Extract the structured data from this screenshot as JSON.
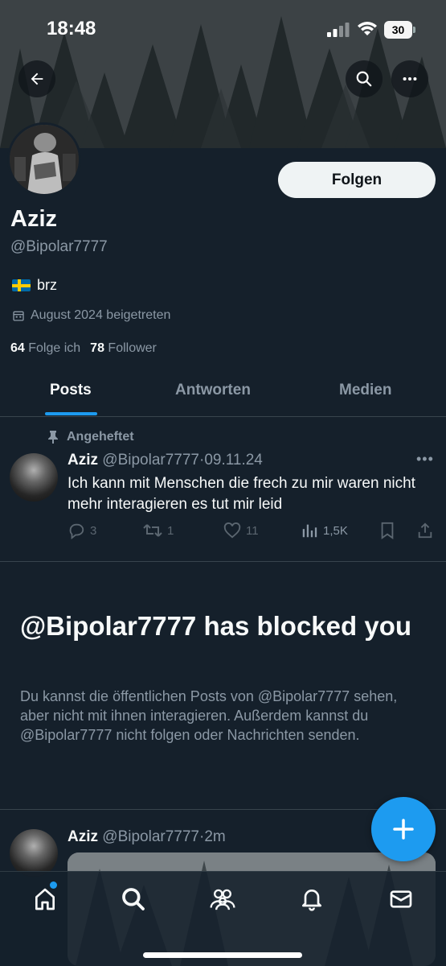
{
  "status_bar": {
    "time": "18:48",
    "battery": "30"
  },
  "profile": {
    "name": "Aziz",
    "handle": "@Bipolar7777",
    "bio": "brz",
    "joined": "August 2024 beigetreten",
    "following_count": "64",
    "following_label": "Folge ich",
    "followers_count": "78",
    "followers_label": "Follower",
    "follow_button": "Folgen"
  },
  "tabs": [
    {
      "label": "Posts",
      "active": true
    },
    {
      "label": "Antworten",
      "active": false
    },
    {
      "label": "Medien",
      "active": false
    }
  ],
  "pinned_tweet": {
    "pinned_label": "Angeheftet",
    "author": "Aziz",
    "handle": "@Bipolar7777",
    "date": "09.11.24",
    "text": "Ich kann mit Menschen die frech zu mir waren nicht mehr interagieren es tut mir leid",
    "replies": "3",
    "retweets": "1",
    "likes": "11",
    "views": "1,5K"
  },
  "blocked": {
    "title": "@Bipolar7777 has blocked you",
    "text": "Du kannst die öffentlichen Posts von @Bipolar7777 sehen, aber nicht mit ihnen interagieren. Außerdem kannst du @Bipolar7777 nicht folgen oder Nachrichten senden."
  },
  "second_tweet": {
    "author": "Aziz",
    "handle": "@Bipolar7777",
    "time": "2m"
  },
  "colors": {
    "background": "#15202b",
    "accent": "#1d9bf0",
    "muted": "#8b98a5",
    "divider": "#38444d"
  },
  "icons": [
    "back-arrow-icon",
    "search-icon",
    "more-icon",
    "flag-icon",
    "calendar-icon",
    "pin-icon",
    "reply-icon",
    "retweet-icon",
    "like-icon",
    "views-icon",
    "bookmark-icon",
    "share-icon",
    "compose-icon",
    "home-icon",
    "communities-icon",
    "notifications-icon",
    "messages-icon"
  ]
}
